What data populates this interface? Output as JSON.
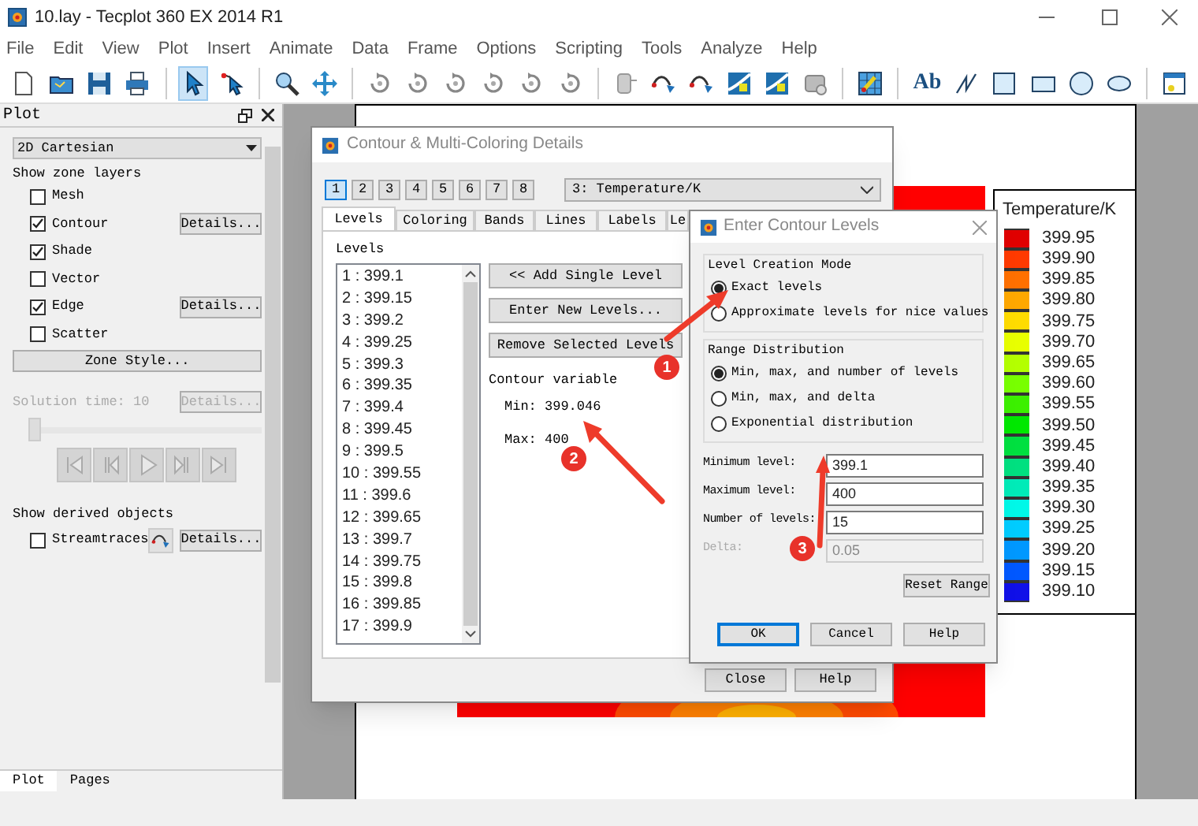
{
  "window": {
    "title": "10.lay - Tecplot 360 EX 2014 R1"
  },
  "menu": [
    "File",
    "Edit",
    "View",
    "Plot",
    "Insert",
    "Animate",
    "Data",
    "Frame",
    "Options",
    "Scripting",
    "Tools",
    "Analyze",
    "Help"
  ],
  "toolbar": [
    {
      "kind": "new",
      "selected": false
    },
    {
      "kind": "open",
      "selected": false
    },
    {
      "kind": "save",
      "selected": false
    },
    {
      "kind": "print",
      "selected": false
    },
    {
      "kind": "separator"
    },
    {
      "kind": "pointer",
      "selected": true
    },
    {
      "kind": "adjuster",
      "selected": false
    },
    {
      "kind": "separator"
    },
    {
      "kind": "zoom",
      "selected": false
    },
    {
      "kind": "move",
      "selected": false
    },
    {
      "kind": "separator"
    },
    {
      "kind": "rotate",
      "selected": false
    },
    {
      "kind": "rotate",
      "selected": false
    },
    {
      "kind": "rotate",
      "selected": false
    },
    {
      "kind": "rotate",
      "selected": false
    },
    {
      "kind": "rotate",
      "selected": false
    },
    {
      "kind": "rotate",
      "selected": false
    },
    {
      "kind": "separator"
    },
    {
      "kind": "probe",
      "selected": false
    },
    {
      "kind": "curve",
      "selected": false
    },
    {
      "kind": "curve",
      "selected": false
    },
    {
      "kind": "contour",
      "selected": false
    },
    {
      "kind": "contour",
      "selected": false
    },
    {
      "kind": "tool",
      "selected": false
    },
    {
      "kind": "separator"
    },
    {
      "kind": "grid",
      "selected": false
    },
    {
      "kind": "separator"
    },
    {
      "kind": "text",
      "label": "Ab",
      "selected": false
    },
    {
      "kind": "line",
      "selected": false
    },
    {
      "kind": "square",
      "selected": false
    },
    {
      "kind": "rectangle",
      "selected": false
    },
    {
      "kind": "circle",
      "selected": false
    },
    {
      "kind": "ellipse",
      "selected": false
    },
    {
      "kind": "separator"
    },
    {
      "kind": "frame",
      "selected": false
    }
  ],
  "plot_panel": {
    "title": "Plot",
    "plot_type": "2D Cartesian",
    "layers_label": "Show zone layers",
    "layers": [
      {
        "label": "Mesh",
        "checked": false
      },
      {
        "label": "Contour",
        "checked": true,
        "details": "Details..."
      },
      {
        "label": "Shade",
        "checked": true
      },
      {
        "label": "Vector",
        "checked": false
      },
      {
        "label": "Edge",
        "checked": true,
        "details": "Details..."
      },
      {
        "label": "Scatter",
        "checked": false
      }
    ],
    "zone_style": "Zone Style...",
    "solution_time": "Solution time: 10",
    "time_details": "Details...",
    "time_slider": {
      "level": 0
    },
    "derived_label": "Show derived objects",
    "streamtraces": {
      "label": "Streamtraces",
      "checked": false,
      "details": "Details..."
    },
    "tabs": [
      {
        "label": "Plot",
        "selected": true
      },
      {
        "label": "Pages",
        "selected": false
      }
    ]
  },
  "legend": {
    "title": "Temperature/K",
    "entries": [
      {
        "label": "399.95",
        "color": "#e00000"
      },
      {
        "label": "399.90",
        "color": "#ff3a00"
      },
      {
        "label": "399.85",
        "color": "#ff7000"
      },
      {
        "label": "399.80",
        "color": "#ffa800"
      },
      {
        "label": "399.75",
        "color": "#ffdc00"
      },
      {
        "label": "399.70",
        "color": "#e8ff00"
      },
      {
        "label": "399.65",
        "color": "#b4ff00"
      },
      {
        "label": "399.60",
        "color": "#78ff00"
      },
      {
        "label": "399.55",
        "color": "#3cf000"
      },
      {
        "label": "399.50",
        "color": "#00e800"
      },
      {
        "label": "399.45",
        "color": "#00e040"
      },
      {
        "label": "399.40",
        "color": "#00e080"
      },
      {
        "label": "399.35",
        "color": "#00ebb8"
      },
      {
        "label": "399.30",
        "color": "#00f8e8"
      },
      {
        "label": "399.25",
        "color": "#00ccff"
      },
      {
        "label": "399.20",
        "color": "#0098ff"
      },
      {
        "label": "399.15",
        "color": "#0058ff"
      },
      {
        "label": "399.10",
        "color": "#1010e8"
      }
    ]
  },
  "contour_dialog": {
    "title": "Contour & Multi-Coloring Details",
    "groups": [
      {
        "label": "1",
        "selected": true
      },
      {
        "label": "2",
        "selected": false
      },
      {
        "label": "3",
        "selected": false
      },
      {
        "label": "4",
        "selected": false
      },
      {
        "label": "5",
        "selected": false
      },
      {
        "label": "6",
        "selected": false
      },
      {
        "label": "7",
        "selected": false
      },
      {
        "label": "8",
        "selected": false
      }
    ],
    "variable": "3: Temperature/K",
    "tabs": [
      {
        "label": "Levels",
        "selected": true
      },
      {
        "label": "Coloring",
        "selected": false
      },
      {
        "label": "Bands",
        "selected": false
      },
      {
        "label": "Lines",
        "selected": false
      },
      {
        "label": "Labels",
        "selected": false
      },
      {
        "label": "Le",
        "selected": false
      }
    ],
    "levels_label": "Levels",
    "levels": [
      "1 : 399.1",
      "2 : 399.15",
      "3 : 399.2",
      "4 : 399.25",
      "5 : 399.3",
      "6 : 399.35",
      "7 : 399.4",
      "8 : 399.45",
      "9 : 399.5",
      "10 : 399.55",
      "11 : 399.6",
      "12 : 399.65",
      "13 : 399.7",
      "14 : 399.75",
      "15 : 399.8",
      "16 : 399.85",
      "17 : 399.9"
    ],
    "buttons": [
      "<< Add Single Level",
      "Enter New Levels...",
      "Remove Selected Levels"
    ],
    "variable_label": "Contour variable",
    "min": "Min: 399.046",
    "max": "Max: 400",
    "footer": [
      "Close",
      "Help"
    ]
  },
  "levels_dialog": {
    "title": "Enter Contour Levels",
    "creation_label": "Level Creation Mode",
    "creation": [
      {
        "label": "Exact levels",
        "selected": true
      },
      {
        "label": "Approximate levels for nice values",
        "selected": false
      }
    ],
    "range_label": "Range Distribution",
    "range": [
      {
        "label": "Min, max, and number of levels",
        "selected": true
      },
      {
        "label": "Min, max, and delta",
        "selected": false
      },
      {
        "label": "Exponential distribution",
        "selected": false
      }
    ],
    "fields": [
      {
        "label": "Minimum level:",
        "value": "399.1",
        "disabled": false
      },
      {
        "label": "Maximum level:",
        "value": "400",
        "disabled": false
      },
      {
        "label": "Number of levels:",
        "value": "15",
        "disabled": false
      },
      {
        "label": "Delta:",
        "value": "0.05",
        "disabled": true
      }
    ],
    "reset": "Reset Range",
    "buttons": [
      "OK",
      "Cancel",
      "Help"
    ]
  },
  "annotations": [
    {
      "label": "1"
    },
    {
      "label": "2"
    },
    {
      "label": "3"
    }
  ]
}
